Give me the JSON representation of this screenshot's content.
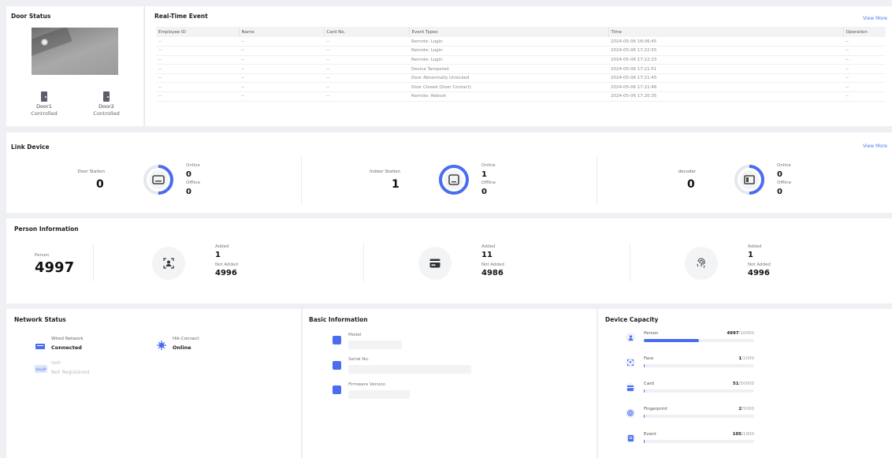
{
  "door_status": {
    "title": "Door Status",
    "doors": [
      {
        "name": "Door1",
        "state": "Controlled"
      },
      {
        "name": "Door2",
        "state": "Controlled"
      }
    ]
  },
  "events": {
    "title": "Real-Time Event",
    "view_more": "View More",
    "columns": [
      "Employee ID",
      "Name",
      "Card No.",
      "Event Types",
      "Time",
      "Operation"
    ],
    "rows": [
      [
        "--",
        "--",
        "--",
        "Remote: Login",
        "2024-05-06 18:06:45",
        "--"
      ],
      [
        "--",
        "--",
        "--",
        "Remote: Login",
        "2024-05-06 17:22:55",
        "--"
      ],
      [
        "--",
        "--",
        "--",
        "Remote: Login",
        "2024-05-06 17:22:23",
        "--"
      ],
      [
        "--",
        "--",
        "--",
        "Device Tampered",
        "2024-05-06 17:21:51",
        "--"
      ],
      [
        "--",
        "--",
        "--",
        "Door Abnormally Unlocked",
        "2024-05-06 17:21:45",
        "--"
      ],
      [
        "--",
        "--",
        "--",
        "Door Closed (Door Contact)",
        "2024-05-06 17:21:46",
        "--"
      ],
      [
        "--",
        "--",
        "--",
        "Remote: Reboot",
        "2024-05-06 17:20:35",
        "--"
      ]
    ]
  },
  "link_device": {
    "title": "Link Device",
    "view_more": "View More",
    "online_label": "Online",
    "offline_label": "Offline",
    "items": [
      {
        "name": "Door Station",
        "count": "0",
        "online": "0",
        "offline": "0",
        "icon": "monitor-icon",
        "online_fraction": 0.5
      },
      {
        "name": "Indoor Station",
        "count": "1",
        "online": "1",
        "offline": "0",
        "icon": "tablet-icon",
        "online_fraction": 1.0
      },
      {
        "name": "decoder",
        "count": "0",
        "online": "0",
        "offline": "0",
        "icon": "decoder-icon",
        "online_fraction": 0.5
      }
    ]
  },
  "person": {
    "title": "Person Information",
    "person_label": "Person",
    "person_count": "4997",
    "added_label": "Added",
    "not_added_label": "Not Added",
    "items": [
      {
        "icon": "face-icon",
        "added": "1",
        "not_added": "4996"
      },
      {
        "icon": "card-icon",
        "added": "11",
        "not_added": "4986"
      },
      {
        "icon": "fingerprint-icon",
        "added": "1",
        "not_added": "4996"
      }
    ]
  },
  "network": {
    "title": "Network Status",
    "wired_label": "Wired Network",
    "wired_value": "Connected",
    "hik_label": "Hik-Connect",
    "hik_value": "Online",
    "voip_label": "VoIP",
    "voip_value": "Not Registered"
  },
  "basic": {
    "title": "Basic Information",
    "model_label": "Model",
    "serial_label": "Serial No.",
    "firmware_label": "Firmware Version"
  },
  "capacity": {
    "title": "Device Capacity",
    "items": [
      {
        "label": "Person",
        "used": "4997",
        "total": "/10000",
        "fraction": 0.4997,
        "icon": "person-icon"
      },
      {
        "label": "Face",
        "used": "1",
        "total": "/1000",
        "fraction": 0.001,
        "icon": "face-icon"
      },
      {
        "label": "Card",
        "used": "51",
        "total": "/50000",
        "fraction": 0.001,
        "icon": "card-icon"
      },
      {
        "label": "Fingerprint",
        "used": "2",
        "total": "/5000",
        "fraction": 0.0004,
        "icon": "fingerprint-icon"
      },
      {
        "label": "Event",
        "used": "105",
        "total": "/1000",
        "fraction": 0.0105,
        "icon": "event-icon"
      }
    ]
  },
  "colors": {
    "accent": "#4a6cf0",
    "ring_track": "#e6e8ee"
  }
}
